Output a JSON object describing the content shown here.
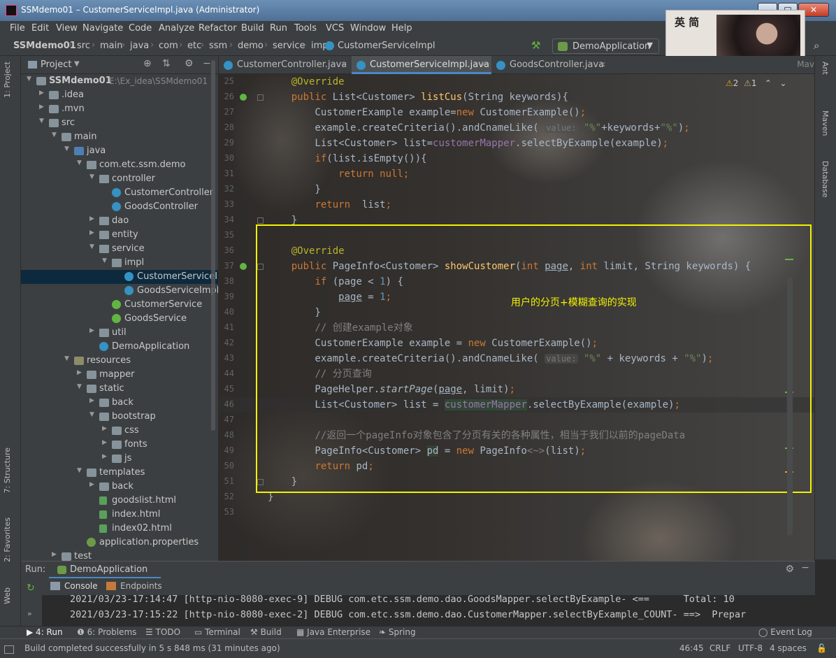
{
  "window": {
    "title": "SSMdemo01 – CustomerServiceImpl.java (Administrator)",
    "buttons": {
      "minimize": "–",
      "maximize": "□",
      "close": "✕"
    }
  },
  "banner": {
    "logo_text": "英 简"
  },
  "menu": [
    "File",
    "Edit",
    "View",
    "Navigate",
    "Code",
    "Analyze",
    "Refactor",
    "Build",
    "Run",
    "Tools",
    "VCS",
    "Window",
    "Help"
  ],
  "breadcrumb": [
    "SSMdemo01",
    "src",
    "main",
    "java",
    "com",
    "etc",
    "ssm",
    "demo",
    "service",
    "impl",
    "CustomerServiceImpl"
  ],
  "run_config": "DemoApplication",
  "project": {
    "title": "Project",
    "tree": [
      {
        "label": "SSMdemo01",
        "path": "E:\\Ex_idea\\SSMdemo01",
        "icon": "folder",
        "twisty": "▼",
        "bold": true
      },
      {
        "label": ".idea",
        "icon": "folder",
        "twisty": "▶"
      },
      {
        "label": ".mvn",
        "icon": "folder",
        "twisty": "▶"
      },
      {
        "label": "src",
        "icon": "folder",
        "twisty": "▼"
      },
      {
        "label": "main",
        "icon": "folder",
        "twisty": "▼"
      },
      {
        "label": "java",
        "icon": "folder-src",
        "twisty": "▼"
      },
      {
        "label": "com.etc.ssm.demo",
        "icon": "pkg",
        "twisty": "▼"
      },
      {
        "label": "controller",
        "icon": "pkg",
        "twisty": "▼"
      },
      {
        "label": "CustomerController",
        "icon": "cls",
        "twisty": ""
      },
      {
        "label": "GoodsController",
        "icon": "cls",
        "twisty": ""
      },
      {
        "label": "dao",
        "icon": "pkg",
        "twisty": "▶"
      },
      {
        "label": "entity",
        "icon": "pkg",
        "twisty": "▶"
      },
      {
        "label": "service",
        "icon": "pkg",
        "twisty": "▼"
      },
      {
        "label": "impl",
        "icon": "pkg",
        "twisty": "▼"
      },
      {
        "label": "CustomerServiceImpl",
        "icon": "cls",
        "twisty": "",
        "selected": true
      },
      {
        "label": "GoodsServiceImpl",
        "icon": "cls",
        "twisty": ""
      },
      {
        "label": "CustomerService",
        "icon": "iface",
        "twisty": ""
      },
      {
        "label": "GoodsService",
        "icon": "iface",
        "twisty": ""
      },
      {
        "label": "util",
        "icon": "pkg",
        "twisty": "▶"
      },
      {
        "label": "DemoApplication",
        "icon": "cls",
        "twisty": ""
      },
      {
        "label": "resources",
        "icon": "folder-res",
        "twisty": "▼"
      },
      {
        "label": "mapper",
        "icon": "folder",
        "twisty": "▶"
      },
      {
        "label": "static",
        "icon": "folder",
        "twisty": "▼"
      },
      {
        "label": "back",
        "icon": "folder",
        "twisty": "▶"
      },
      {
        "label": "bootstrap",
        "icon": "folder",
        "twisty": "▼"
      },
      {
        "label": "css",
        "icon": "folder",
        "twisty": "▶"
      },
      {
        "label": "fonts",
        "icon": "folder",
        "twisty": "▶"
      },
      {
        "label": "js",
        "icon": "folder",
        "twisty": "▶"
      },
      {
        "label": "templates",
        "icon": "folder",
        "twisty": "▼"
      },
      {
        "label": "back",
        "icon": "folder",
        "twisty": "▶"
      },
      {
        "label": "goodslist.html",
        "icon": "file",
        "twisty": ""
      },
      {
        "label": "index.html",
        "icon": "file",
        "twisty": ""
      },
      {
        "label": "index02.html",
        "icon": "file",
        "twisty": ""
      },
      {
        "label": "application.properties",
        "icon": "props",
        "twisty": ""
      },
      {
        "label": "test",
        "icon": "folder",
        "twisty": "▶"
      }
    ]
  },
  "left_tools": {
    "project": "1: Project",
    "structure": "7: Structure",
    "favorites": "2: Favorites",
    "web": "Web"
  },
  "right_tools": {
    "ant": "Ant",
    "maven": "Maven",
    "database": "Database"
  },
  "editor": {
    "tabs": [
      "CustomerController.java",
      "CustomerServiceImpl.java",
      "GoodsController.java"
    ],
    "active_tab": 1,
    "more": "Mav",
    "warnings": "2",
    "weak_warnings": "1",
    "line_numbers": [
      "25",
      "26",
      "27",
      "28",
      "29",
      "30",
      "31",
      "32",
      "33",
      "34",
      "35",
      "36",
      "37",
      "38",
      "39",
      "40",
      "41",
      "42",
      "43",
      "44",
      "45",
      "46",
      "47",
      "48",
      "49",
      "50",
      "51",
      "52",
      "53"
    ],
    "current_line": "46",
    "callout": "用户的分页+模糊查询的实现"
  },
  "run": {
    "label": "Run:",
    "app": "DemoApplication",
    "tabs": [
      "Console",
      "Endpoints"
    ],
    "log": [
      "2021/03/23-17:14:47 [http-nio-8080-exec-9] DEBUG com.etc.ssm.demo.dao.GoodsMapper.selectByExample- <==      Total: 10",
      "2021/03/23-17:15:22 [http-nio-8080-exec-2] DEBUG com.etc.ssm.demo.dao.CustomerMapper.selectByExample_COUNT- ==>  Prepar"
    ]
  },
  "bottom_tools": [
    "4: Run",
    "6: Problems",
    "TODO",
    "Terminal",
    "Build",
    "Java Enterprise",
    "Spring"
  ],
  "status": {
    "message": "Build completed successfully in 5 s 848 ms (31 minutes ago)",
    "position": "46:45",
    "line_sep": "CRLF",
    "encoding": "UTF-8",
    "indent": "4 spaces",
    "event_log": "Event Log"
  }
}
